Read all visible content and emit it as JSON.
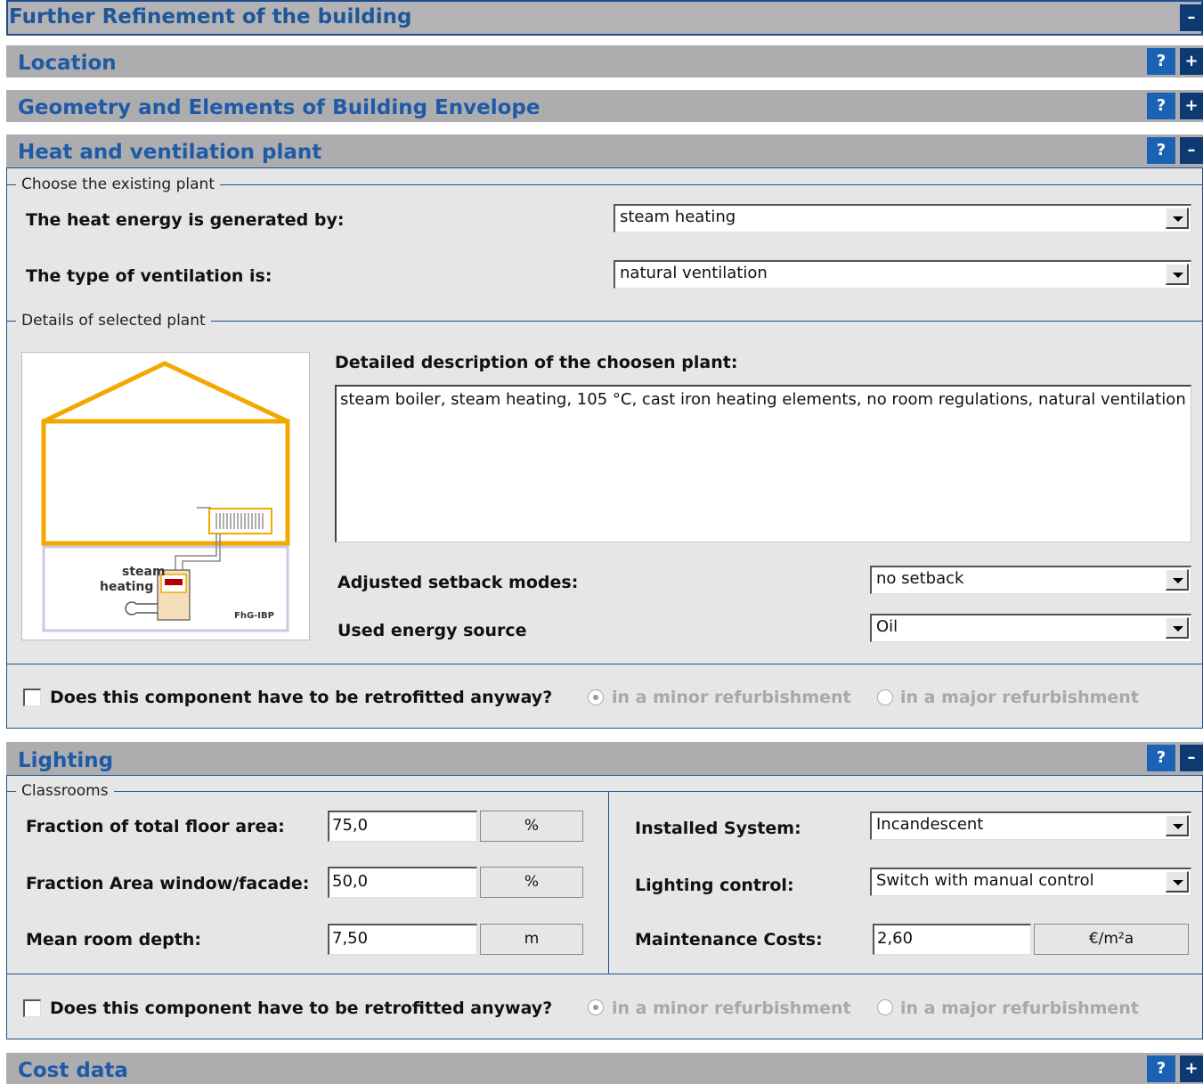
{
  "page_title": "Further Refinement of the building",
  "title_toggle": "–",
  "sections": {
    "location": {
      "title": "Location",
      "help": "?",
      "toggle": "+"
    },
    "geometry": {
      "title": "Geometry and Elements of Building Envelope",
      "help": "?",
      "toggle": "+"
    },
    "heat": {
      "title": "Heat and ventilation plant",
      "help": "?",
      "toggle": "–"
    },
    "lighting": {
      "title": "Lighting",
      "help": "?",
      "toggle": "–"
    },
    "cost": {
      "title": "Cost data",
      "help": "?",
      "toggle": "+"
    }
  },
  "heat": {
    "group_existing": "Choose the existing plant",
    "heat_label": "The heat energy is generated by:",
    "heat_value": "steam heating",
    "vent_label": "The type of ventilation is:",
    "vent_value": "natural ventilation",
    "group_details": "Details of selected plant",
    "desc_label": "Detailed description of the choosen plant:",
    "desc_text": "steam boiler, steam heating, 105 °C, cast iron heating elements, no room regulations, natural ventilation",
    "setback_label": "Adjusted setback modes:",
    "setback_value": "no setback",
    "energy_label": "Used energy source",
    "energy_value": "Oil",
    "illustration": {
      "caption": "steam heating",
      "credit": "FhG-IBP"
    },
    "retrofit_question": "Does this component have to be retrofitted anyway?",
    "retrofit_checked": false,
    "minor_label": "in a minor refurbishment",
    "major_label": "in a major refurbishment",
    "selected_option": "minor"
  },
  "lighting": {
    "group": "Classrooms",
    "fraction_floor_label": "Fraction of total floor area:",
    "fraction_floor_value": "75,0",
    "fraction_floor_unit": "%",
    "fraction_window_label": "Fraction Area window/facade:",
    "fraction_window_value": "50,0",
    "fraction_window_unit": "%",
    "depth_label": "Mean room depth:",
    "depth_value": "7,50",
    "depth_unit": "m",
    "system_label": "Installed System:",
    "system_value": "Incandescent",
    "control_label": "Lighting control:",
    "control_value": "Switch with manual control",
    "maint_label": "Maintenance Costs:",
    "maint_value": "2,60",
    "maint_unit": "€/m²a",
    "retrofit_question": "Does this component have to be retrofitted anyway?",
    "retrofit_checked": false,
    "minor_label": "in a minor refurbishment",
    "major_label": "in a major refurbishment",
    "selected_option": "minor"
  },
  "colors": {
    "header_bg": "#adadb0",
    "title_text": "#1f5aa6",
    "help_button": "#1c62b4",
    "toggle_button": "#0e3a74",
    "panel_bg": "#e6e6e6",
    "illustration_accent": "#f2a800"
  }
}
